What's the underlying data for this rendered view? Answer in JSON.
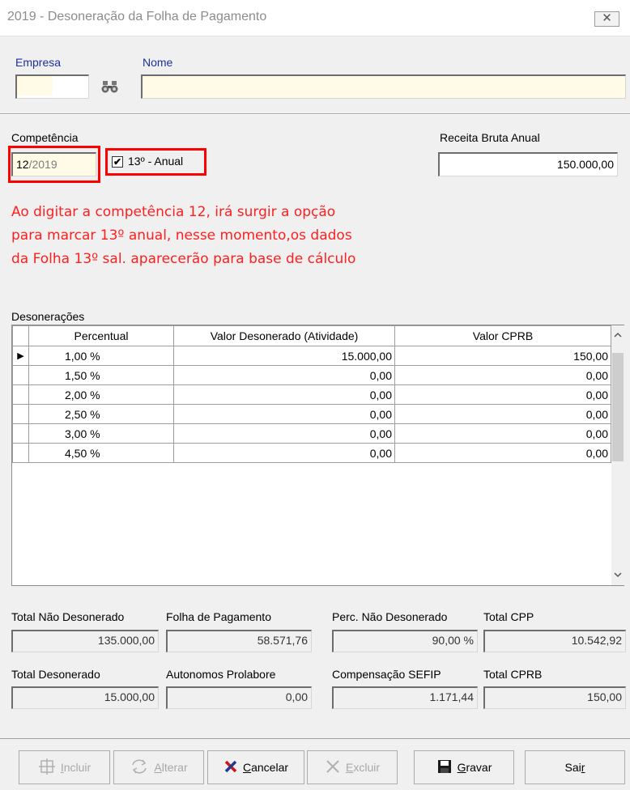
{
  "window": {
    "title": "2019 - Desoneração da Folha de Pagamento",
    "close_label": "✕"
  },
  "empresa": {
    "label": "Empresa",
    "value": ""
  },
  "nome": {
    "label": "Nome",
    "value": ""
  },
  "competencia": {
    "label": "Competência",
    "value_month": "12",
    "value_rest": "/2019"
  },
  "anual": {
    "label": "13º - Anual",
    "checked": true,
    "check_glyph": "✔"
  },
  "receita": {
    "label": "Receita Bruta Anual",
    "value": "150.000,00"
  },
  "note": [
    "Ao digitar a competência 12, irá surgir a opção",
    "para marcar 13º anual, nesse momento,os dados",
    "da Folha 13º sal. aparecerão para base de cálculo"
  ],
  "desoneracoes": {
    "label": "Desonerações",
    "columns": [
      "Percentual",
      "Valor Desonerado (Atividade)",
      "Valor CPRB"
    ],
    "rows": [
      {
        "pct": "1,00 %",
        "valor": "15.000,00",
        "cprb": "150,00"
      },
      {
        "pct": "1,50 %",
        "valor": "0,00",
        "cprb": "0,00"
      },
      {
        "pct": "2,00 %",
        "valor": "0,00",
        "cprb": "0,00"
      },
      {
        "pct": "2,50 %",
        "valor": "0,00",
        "cprb": "0,00"
      },
      {
        "pct": "3,00 %",
        "valor": "0,00",
        "cprb": "0,00"
      },
      {
        "pct": "4,50 %",
        "valor": "0,00",
        "cprb": "0,00"
      }
    ]
  },
  "totals": {
    "total_nao_desonerado": {
      "label": "Total Não Desonerado",
      "value": "135.000,00"
    },
    "folha_pagamento": {
      "label": "Folha de Pagamento",
      "value": "58.571,76"
    },
    "perc_nao_desonerado": {
      "label": "Perc. Não Desonerado",
      "value": "90,00 %"
    },
    "total_cpp": {
      "label": "Total CPP",
      "value": "10.542,92"
    },
    "total_desonerado": {
      "label": "Total Desonerado",
      "value": "15.000,00"
    },
    "autonomos": {
      "label": "Autonomos Prolabore",
      "value": "0,00"
    },
    "compensacao": {
      "label": "Compensação SEFIP",
      "value": "1.171,44"
    },
    "total_cprb": {
      "label": "Total CPRB",
      "value": "150,00"
    }
  },
  "buttons": {
    "incluir": {
      "pre": "",
      "u": "I",
      "post": "ncluir"
    },
    "alterar": {
      "pre": "",
      "u": "A",
      "post": "lterar"
    },
    "cancelar": {
      "pre": "",
      "u": "C",
      "post": "ancelar"
    },
    "excluir": {
      "pre": "",
      "u": "E",
      "post": "xcluir"
    },
    "gravar": {
      "pre": "",
      "u": "G",
      "post": "ravar"
    },
    "sair": {
      "pre": "Sai",
      "u": "r",
      "post": ""
    }
  },
  "colors": {
    "highlight": "#ff0000",
    "note": "#ff1f1f",
    "label_blue": "#1d2f9e"
  }
}
